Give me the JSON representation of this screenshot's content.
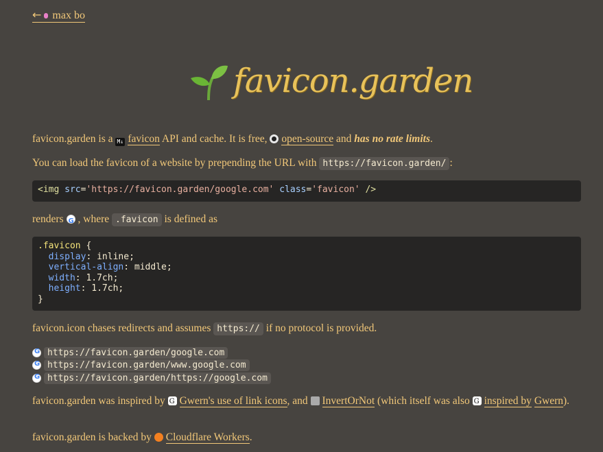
{
  "back_link": {
    "arrow": "←",
    "label": "max bo"
  },
  "header": {
    "title": "favicon.garden",
    "logo_icon": "sprout-icon"
  },
  "intro": {
    "p1_a": "favicon.garden is a ",
    "favicon_link": "favicon",
    "p1_b": " API and cache. It is free, ",
    "opensource_link": "open-source",
    "p1_c": " and ",
    "emph": "has no rate limits",
    "p1_d": "."
  },
  "load": {
    "text": "You can load the favicon of a website by prepending the URL with ",
    "code": "https://favicon.garden/",
    "end": ":"
  },
  "example_code": {
    "tag_open": "<img",
    "attr1": "src",
    "val1": "'https://favicon.garden/google.com'",
    "attr2": "class",
    "val2": "'favicon'",
    "tag_close": "/>"
  },
  "renders": {
    "a": "renders ",
    "b": ", where ",
    "code": ".favicon",
    "c": " is defined as"
  },
  "css_code": {
    "selector": ".favicon",
    "open": "{",
    "rules": [
      {
        "prop": "display",
        "value": "inline"
      },
      {
        "prop": "vertical-align",
        "value": "middle"
      },
      {
        "prop": "width",
        "value": "1.7ch"
      },
      {
        "prop": "height",
        "value": "1.7ch"
      }
    ],
    "close": "}"
  },
  "redirects": {
    "a": "favicon.icon chases redirects and assumes ",
    "code": "https://",
    "b": " if no protocol is provided."
  },
  "urls": [
    "https://favicon.garden/google.com",
    "https://favicon.garden/www.google.com",
    "https://favicon.garden/https://google.com"
  ],
  "inspired": {
    "a": "favicon.garden was inspired by ",
    "link1": "Gwern's use of link icons",
    "b": ", and ",
    "link2": "InvertOrNot",
    "c": " (which itself was also ",
    "link3a": "inspired by",
    "link3b": "Gwern",
    "d": ")."
  },
  "backed": {
    "a": "favicon.garden is backed by ",
    "link": "Cloudflare Workers",
    "b": "."
  },
  "colors": {
    "background": "#474440",
    "text": "#f2c879",
    "code_bg": "#262524",
    "inline_code_bg": "#5a5652"
  }
}
